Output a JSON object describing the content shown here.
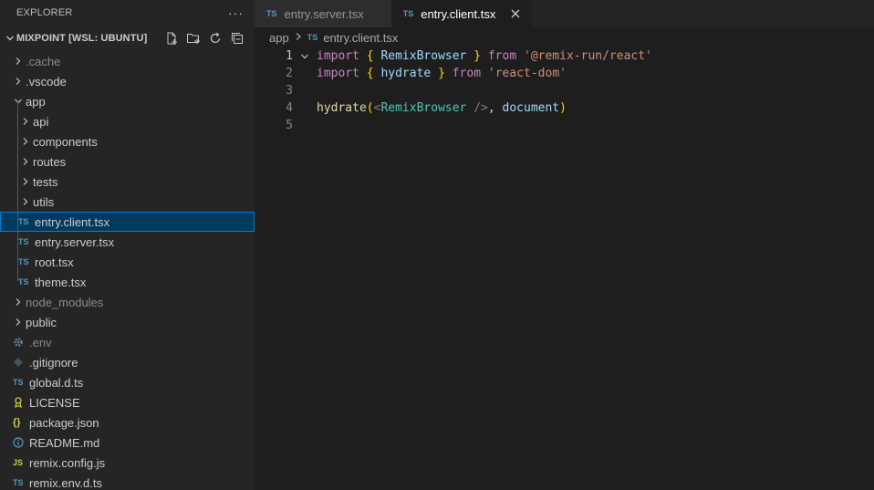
{
  "sidebar": {
    "title": "EXPLORER",
    "more": "···",
    "workspace": "MIXPOINT [WSL: UBUNTU]",
    "tree": [
      {
        "label": ".cache",
        "type": "folder",
        "level": 0,
        "dim": true
      },
      {
        "label": ".vscode",
        "type": "folder",
        "level": 0
      },
      {
        "label": "app",
        "type": "folder-open",
        "level": 0
      },
      {
        "label": "api",
        "type": "folder",
        "level": 1
      },
      {
        "label": "components",
        "type": "folder",
        "level": 1
      },
      {
        "label": "routes",
        "type": "folder",
        "level": 1
      },
      {
        "label": "tests",
        "type": "folder",
        "level": 1
      },
      {
        "label": "utils",
        "type": "folder",
        "level": 1
      },
      {
        "label": "entry.client.tsx",
        "type": "ts",
        "level": 1,
        "selected": true
      },
      {
        "label": "entry.server.tsx",
        "type": "ts",
        "level": 1
      },
      {
        "label": "root.tsx",
        "type": "ts",
        "level": 1
      },
      {
        "label": "theme.tsx",
        "type": "ts",
        "level": 1
      },
      {
        "label": "node_modules",
        "type": "folder",
        "level": 0,
        "dim": true
      },
      {
        "label": "public",
        "type": "folder",
        "level": 0
      },
      {
        "label": ".env",
        "type": "env",
        "level": 0,
        "dim": true
      },
      {
        "label": ".gitignore",
        "type": "git",
        "level": 0
      },
      {
        "label": "global.d.ts",
        "type": "ts",
        "level": 0
      },
      {
        "label": "LICENSE",
        "type": "license",
        "level": 0
      },
      {
        "label": "package.json",
        "type": "json",
        "level": 0
      },
      {
        "label": "README.md",
        "type": "info",
        "level": 0
      },
      {
        "label": "remix.config.js",
        "type": "js",
        "level": 0
      },
      {
        "label": "remix.env.d.ts",
        "type": "ts",
        "level": 0
      }
    ]
  },
  "badges": {
    "ts": "TS",
    "js": "JS",
    "json": "{}"
  },
  "tabs": [
    {
      "label": "entry.server.tsx",
      "active": false
    },
    {
      "label": "entry.client.tsx",
      "active": true
    }
  ],
  "breadcrumb": {
    "folder": "app",
    "file": "entry.client.tsx"
  },
  "editor": {
    "line_numbers": [
      "1",
      "2",
      "3",
      "4",
      "5"
    ],
    "lines": [
      [
        {
          "t": "import",
          "c": "kw"
        },
        {
          "t": " ",
          "c": "txt"
        },
        {
          "t": "{",
          "c": "br"
        },
        {
          "t": " RemixBrowser ",
          "c": "id"
        },
        {
          "t": "}",
          "c": "br"
        },
        {
          "t": " ",
          "c": "txt"
        },
        {
          "t": "from",
          "c": "kw"
        },
        {
          "t": " ",
          "c": "txt"
        },
        {
          "t": "'@remix-run/react'",
          "c": "str"
        }
      ],
      [
        {
          "t": "import",
          "c": "kw"
        },
        {
          "t": " ",
          "c": "txt"
        },
        {
          "t": "{",
          "c": "br"
        },
        {
          "t": " hydrate ",
          "c": "id"
        },
        {
          "t": "}",
          "c": "br"
        },
        {
          "t": " ",
          "c": "txt"
        },
        {
          "t": "from",
          "c": "kw"
        },
        {
          "t": " ",
          "c": "txt"
        },
        {
          "t": "'react-dom'",
          "c": "str"
        }
      ],
      [],
      [
        {
          "t": "hydrate",
          "c": "fn"
        },
        {
          "t": "(",
          "c": "br"
        },
        {
          "t": "<",
          "c": "punct"
        },
        {
          "t": "RemixBrowser",
          "c": "tag"
        },
        {
          "t": " ",
          "c": "txt"
        },
        {
          "t": "/>",
          "c": "punct"
        },
        {
          "t": ", ",
          "c": "txt"
        },
        {
          "t": "document",
          "c": "id"
        },
        {
          "t": ")",
          "c": "br"
        }
      ],
      []
    ]
  },
  "colors": {
    "accent": "#007fd4",
    "selection": "#04395e",
    "ts_icon": "#519aba"
  }
}
